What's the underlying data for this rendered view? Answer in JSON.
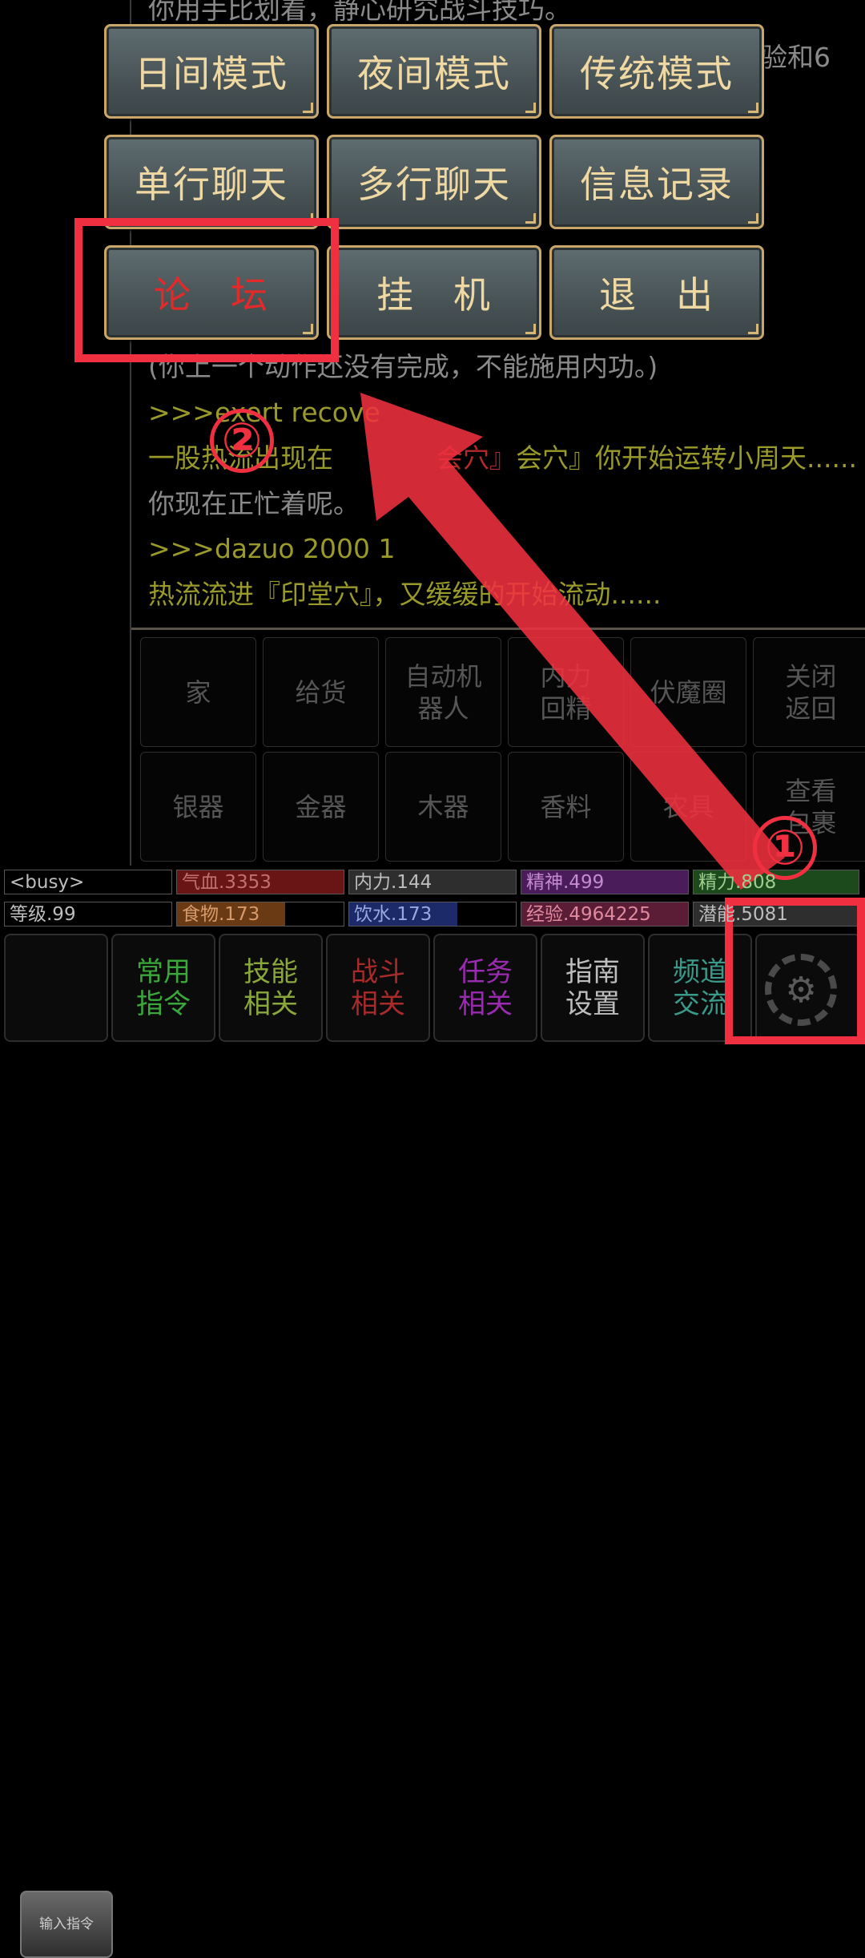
{
  "log": {
    "lines": [
      "你用手比划着，静心研究战斗技巧。",
      "验和6",
      "(你上一个动作还没有完成，不能施用内功。)",
      ">>>exert recove",
      "一股热流出现在",
      "会穴』你开始运转小周天......",
      "你现在正忙着呢。",
      ">>>dazuo 2000 1",
      "热流流进『印堂穴』，又缓缓的开始流动......"
    ]
  },
  "mode_menu": {
    "day_mode": "日间模式",
    "night_mode": "夜间模式",
    "classic_mode": "传统模式",
    "single_chat": "单行聊天",
    "multi_chat": "多行聊天",
    "info_log": "信息记录",
    "forum": "论　坛",
    "idle": "挂　机",
    "exit": "退　出"
  },
  "quick": {
    "row1": [
      "家",
      "给货",
      "自动机\n器人",
      "内力\n回精",
      "伏魔圈",
      "关闭\n返回"
    ],
    "row2": [
      "银器",
      "金器",
      "木器",
      "香料",
      "农具",
      "查看\n包裹"
    ]
  },
  "stats": {
    "busy": "<busy>",
    "qixue": "气血.3353",
    "neili": "内力.144",
    "jingshen": "精神.499",
    "jingli": "精力.808",
    "dengji": "等级.99",
    "shiwu": "食物.173",
    "yinshui": "饮水.173",
    "jingyan": "经验.4964225",
    "qianneng": "潜能.5081"
  },
  "bottom_bar": {
    "input_cmd": "输入指令",
    "common": "常用\n指令",
    "skills": "技能\n相关",
    "combat": "战斗\n相关",
    "quest": "任务\n相关",
    "guide": "指南\n设置",
    "channel": "频道\n交流",
    "settings_icon": "gear-icon"
  },
  "annotations": {
    "step1": "①",
    "step2": "②"
  },
  "colors": {
    "annotation_red": "#f03040",
    "button_gold": "#f0d8a2",
    "button_border": "#c9a76a"
  }
}
